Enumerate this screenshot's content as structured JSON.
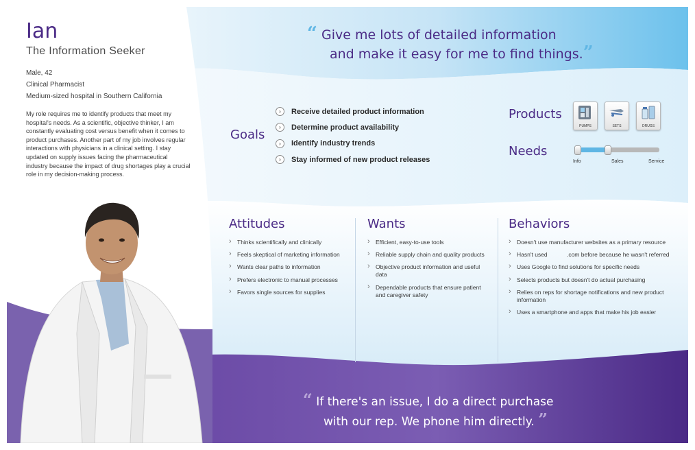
{
  "persona": {
    "name": "Ian",
    "role": "The Information Seeker",
    "facts": [
      "Male, 42",
      "Clinical Pharmacist",
      "Medium-sized hospital in Southern California"
    ],
    "bio": "My role requires me to identify products that meet my hospital's needs. As a scientific, objective thinker, I am constantly evaluating cost versus benefit when it comes to product purchases. Another part of my job involves regular interactions with physicians in a clinical setting. I stay updated on supply issues facing the pharmaceutical industry because the impact of drug shortages play a crucial role in my decision-making process."
  },
  "quote_top": {
    "open": "“",
    "line1": "Give me lots of detailed information",
    "line2": "and make it easy for me to find things.",
    "close": "”"
  },
  "goals": {
    "heading": "Goals",
    "items": [
      "Receive detailed product information",
      "Determine product availability",
      "Identify industry trends",
      "Stay informed of new product releases"
    ]
  },
  "products": {
    "heading": "Products",
    "items": [
      {
        "label": "PUMPS",
        "icon": "pump-icon"
      },
      {
        "label": "SETS",
        "icon": "iv-set-icon"
      },
      {
        "label": "DRUGS",
        "icon": "drug-vial-icon"
      }
    ]
  },
  "needs": {
    "heading": "Needs",
    "labels": [
      "Info",
      "Sales",
      "Service"
    ],
    "level": 0.38,
    "colors": {
      "fill": "#5fb6e4",
      "track": "#b8b8b8"
    }
  },
  "attitudes": {
    "heading": "Attitudes",
    "items": [
      "Thinks scientifically and clinically",
      "Feels skeptical of marketing information",
      "Wants clear paths to information",
      "Prefers electronic to manual processes",
      "Favors single sources for supplies"
    ]
  },
  "wants": {
    "heading": "Wants",
    "items": [
      "Efficient, easy-to-use tools",
      "Reliable supply chain and quality products",
      "Objective product information and useful data",
      "Dependable products that ensure patient and caregiver safety"
    ]
  },
  "behaviors": {
    "heading": "Behaviors",
    "items": [
      "Doesn't use manufacturer websites as a primary resource",
      "Hasn't used            .com before because he wasn't referred",
      "Uses Google to find solutions for specific needs",
      "Selects products but doesn't do actual purchasing",
      "Relies on reps for shortage notifications and new product information",
      "Uses a smartphone and apps that make his job easier"
    ]
  },
  "quote_bottom": {
    "open": "“",
    "line1": "If there's an issue, I do a direct purchase",
    "line2": "with our rep. We phone him directly.",
    "close": "”"
  },
  "colors": {
    "accent_purple": "#4b2b86",
    "accent_blue": "#5fb6e4",
    "footer_purple": "#5b3a97"
  }
}
